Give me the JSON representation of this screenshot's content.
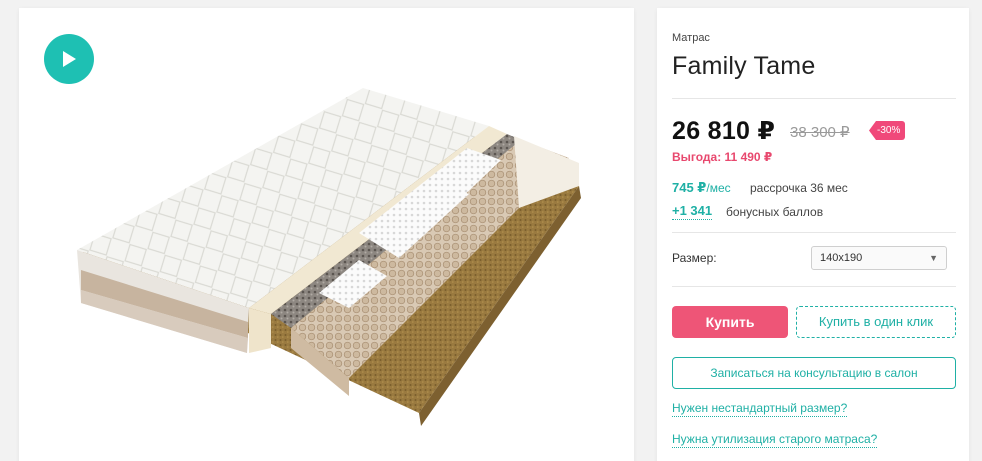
{
  "gallery": {
    "play_icon": "play-icon",
    "image": "mattress-cutaway"
  },
  "product": {
    "category": "Матрас",
    "title": "Family Tame"
  },
  "price": {
    "current": "26 810 ₽",
    "old": "38 300 ₽",
    "discount": "-30%",
    "benefit": "Выгода: 11 490 ₽"
  },
  "installment": {
    "amount": "745 ₽",
    "per": "/мес",
    "text": "рассрочка 36 мес"
  },
  "bonus": {
    "value": "+1 341",
    "text": "бонусных баллов"
  },
  "size": {
    "label": "Размер:",
    "selected": "140x190"
  },
  "actions": {
    "buy": "Купить",
    "one_click": "Купить в один клик",
    "consult": "Записаться на консультацию в салон"
  },
  "links": {
    "custom_size": "Нужен нестандартный размер?",
    "recycle": "Нужна утилизация старого матраса?"
  },
  "colors": {
    "accent": "#1ec0b3",
    "buy": "#ee5577",
    "discount": "#f0497a"
  }
}
